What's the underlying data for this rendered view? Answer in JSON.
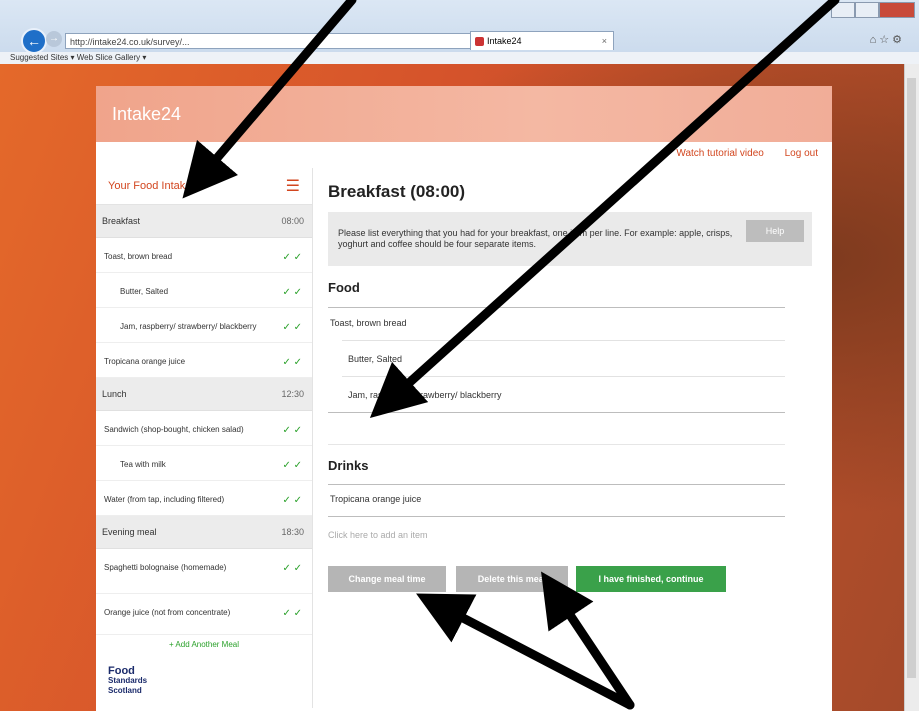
{
  "browser": {
    "address": "http://intake24.co.uk/survey/...",
    "tab_title": "Intake24",
    "favorites": "Suggested Sites ▾  Web Slice Gallery ▾"
  },
  "app": {
    "logo": "Intake24",
    "nav": {
      "watch_video": "Watch tutorial video",
      "logout": "Log out"
    }
  },
  "sidebar": {
    "title": "Your Food Intake",
    "meals": [
      {
        "name": "Breakfast",
        "time": "08:00"
      },
      {
        "name": "Lunch",
        "time": "12:30"
      },
      {
        "name": "Evening meal",
        "time": "18:30"
      }
    ],
    "foods": {
      "breakfast": [
        {
          "name": "Toast, brown bread",
          "sub": false,
          "check": "✓ ✓"
        },
        {
          "name": "Butter, Salted",
          "sub": true,
          "check": "✓ ✓"
        },
        {
          "name": "Jam, raspberry/ strawberry/ blackberry",
          "sub": true,
          "check": "✓ ✓"
        },
        {
          "name": "Tropicana orange juice",
          "sub": false,
          "check": "✓ ✓"
        }
      ],
      "lunch": [
        {
          "name": "Sandwich (shop-bought, chicken salad)",
          "sub": false,
          "check": "✓ ✓"
        },
        {
          "name": "Tea with milk",
          "sub": true,
          "check": "✓ ✓"
        },
        {
          "name": "Water (from tap, including filtered)",
          "sub": false,
          "check": "✓ ✓"
        }
      ],
      "evening": [
        {
          "name": "Spaghetti bolognaise (homemade)",
          "sub": false,
          "check": "✓ ✓"
        },
        {
          "name": "Orange juice (not from concentrate)",
          "sub": false,
          "check": "✓ ✓"
        }
      ]
    },
    "add_food": "+ Add Another Meal",
    "fss": [
      "Food",
      "Standards",
      "Scotland"
    ]
  },
  "main": {
    "title": "Breakfast (08:00)",
    "info": "Please list everything that you had for your breakfast, one item per line. For example: apple, crisps, yoghurt and coffee should be four separate items.",
    "help_label": "Help",
    "food_header": "Food",
    "food_items": [
      "Toast, brown bread",
      "Butter, Salted",
      "Jam, raspberry/ strawberry/ blackberry"
    ],
    "drinks_header": "Drinks",
    "drink_items": [
      "Tropicana orange juice"
    ],
    "add_placeholder": "Click here to add an item",
    "buttons": {
      "change_time": "Change meal time",
      "delete_meal": "Delete this meal",
      "finish": "I have finished, continue"
    }
  }
}
